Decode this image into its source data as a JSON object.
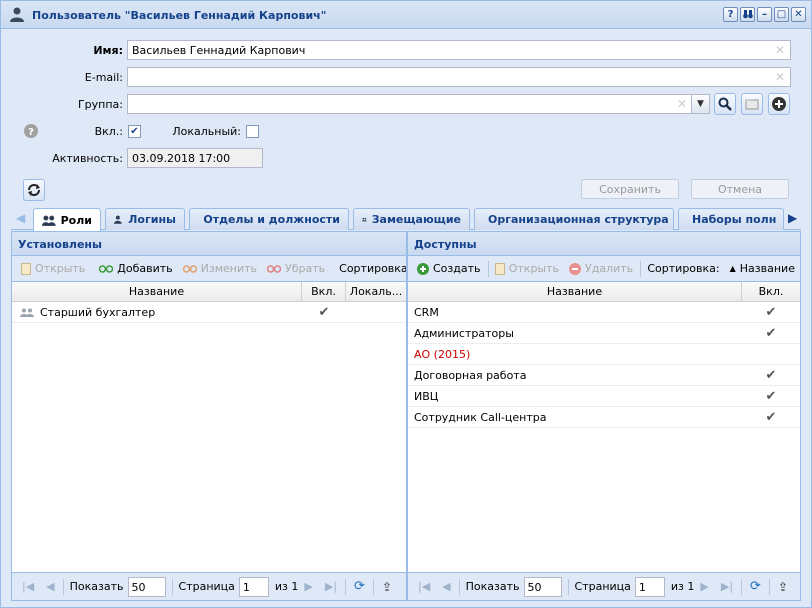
{
  "window": {
    "title": "Пользователь \"Васильев Геннадий Карпович\"",
    "buttons": [
      "?",
      "⌂",
      "–",
      "□",
      "✕"
    ]
  },
  "form": {
    "name_label": "Имя:",
    "name_value": "Васильев Геннадий Карпович",
    "email_label": "E-mail:",
    "email_value": "",
    "group_label": "Группа:",
    "group_value": "",
    "enabled_label": "Вкл.:",
    "enabled_checked": true,
    "local_label": "Локальный:",
    "local_checked": false,
    "activity_label": "Активность:",
    "activity_value": "03.09.2018 17:00",
    "save_label": "Сохранить",
    "cancel_label": "Отмена"
  },
  "tabs": [
    {
      "label": "Роли",
      "icon": "users-icon",
      "active": true
    },
    {
      "label": "Логины",
      "icon": "user-key-icon"
    },
    {
      "label": "Отделы и должности",
      "icon": "person-badge-icon"
    },
    {
      "label": "Замещающие",
      "icon": "users-icon"
    },
    {
      "label": "Организационная структура",
      "icon": "org-structure-icon"
    },
    {
      "label": "Наборы полн",
      "icon": "basket-icon"
    }
  ],
  "installed": {
    "title": "Установлены",
    "toolbar": {
      "open": "Открыть",
      "add": "Добавить",
      "edit": "Изменить",
      "remove": "Убрать",
      "sort": "Сортировка:"
    },
    "columns": [
      "Название",
      "Вкл.",
      "Локаль..."
    ],
    "rows": [
      {
        "name": "Старший бухгалтер",
        "enabled": "✔",
        "local": ""
      }
    ],
    "pager": {
      "show": "Показать",
      "page_size": "50",
      "page": "Страница",
      "page_value": "1",
      "of": "из 1"
    }
  },
  "available": {
    "title": "Доступны",
    "toolbar": {
      "create": "Создать",
      "open": "Открыть",
      "delete": "Удалить",
      "sort": "Сортировка:",
      "sort_value": "Название"
    },
    "columns": [
      "Название",
      "Вкл."
    ],
    "rows": [
      {
        "name": "CRM",
        "enabled": "✔",
        "red": false
      },
      {
        "name": "Администраторы",
        "enabled": "✔",
        "red": false
      },
      {
        "name": "АО (2015)",
        "enabled": "",
        "red": true
      },
      {
        "name": "Договорная работа",
        "enabled": "✔",
        "red": false
      },
      {
        "name": "ИВЦ",
        "enabled": "✔",
        "red": false
      },
      {
        "name": "Сотрудник Call-центра",
        "enabled": "✔",
        "red": false
      }
    ],
    "pager": {
      "show": "Показать",
      "page_size": "50",
      "page": "Страница",
      "page_value": "1",
      "of": "из 1"
    }
  },
  "colors": {
    "accent": "#15428b",
    "border": "#99bbe8",
    "panel": "#dfe8f6",
    "red_text": "#cc0000",
    "add_green": "#3a9a3a"
  }
}
